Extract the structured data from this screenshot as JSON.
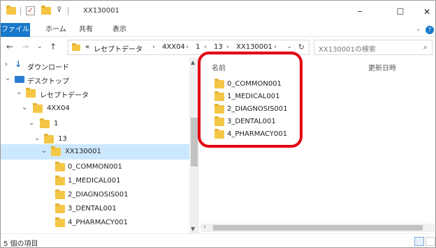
{
  "window": {
    "title": "XX130001",
    "controls": {
      "minimize": "–",
      "maximize": "☐",
      "close": "✕"
    }
  },
  "ribbon": {
    "file": "ファイル",
    "tabs": [
      "ホーム",
      "共有",
      "表示"
    ]
  },
  "address": {
    "prefix": "«",
    "crumbs": [
      "レセプトデータ",
      "4XX04",
      "1",
      "13",
      "XX130001"
    ],
    "separator": "›"
  },
  "search": {
    "placeholder": "XX130001の検索"
  },
  "nav_tree": [
    {
      "label": "ダウンロード",
      "icon": "download-icon",
      "chevron": "›"
    },
    {
      "label": "デスクトップ",
      "icon": "desktop-icon",
      "chevron": "⌄"
    },
    {
      "label": "レセプトデータ",
      "icon": "folder-icon",
      "chevron": "⌄"
    },
    {
      "label": "4XX04",
      "icon": "folder-icon",
      "chevron": "⌄"
    },
    {
      "label": "1",
      "icon": "folder-icon",
      "chevron": "⌄"
    },
    {
      "label": "13",
      "icon": "folder-icon",
      "chevron": "⌄"
    },
    {
      "label": "XX130001",
      "icon": "folder-icon",
      "chevron": "⌄",
      "selected": true
    },
    {
      "label": "0_COMMON001",
      "icon": "folder-icon",
      "chevron": ""
    },
    {
      "label": "1_MEDICAL001",
      "icon": "folder-icon",
      "chevron": ""
    },
    {
      "label": "2_DIAGNOSIS001",
      "icon": "folder-icon",
      "chevron": ""
    },
    {
      "label": "3_DENTAL001",
      "icon": "folder-icon",
      "chevron": ""
    },
    {
      "label": "4_PHARMACY001",
      "icon": "folder-icon",
      "chevron": ""
    }
  ],
  "content": {
    "columns": {
      "name": "名前",
      "modified": "更新日時"
    },
    "files": [
      "0_COMMON001",
      "1_MEDICAL001",
      "2_DIAGNOSIS001",
      "3_DENTAL001",
      "4_PHARMACY001"
    ]
  },
  "status": {
    "count_text": "5 個の項目"
  },
  "colors": {
    "accent": "#1979ca",
    "selection": "#cce8ff",
    "folder": "#f4c646",
    "highlight": "#e60012"
  }
}
